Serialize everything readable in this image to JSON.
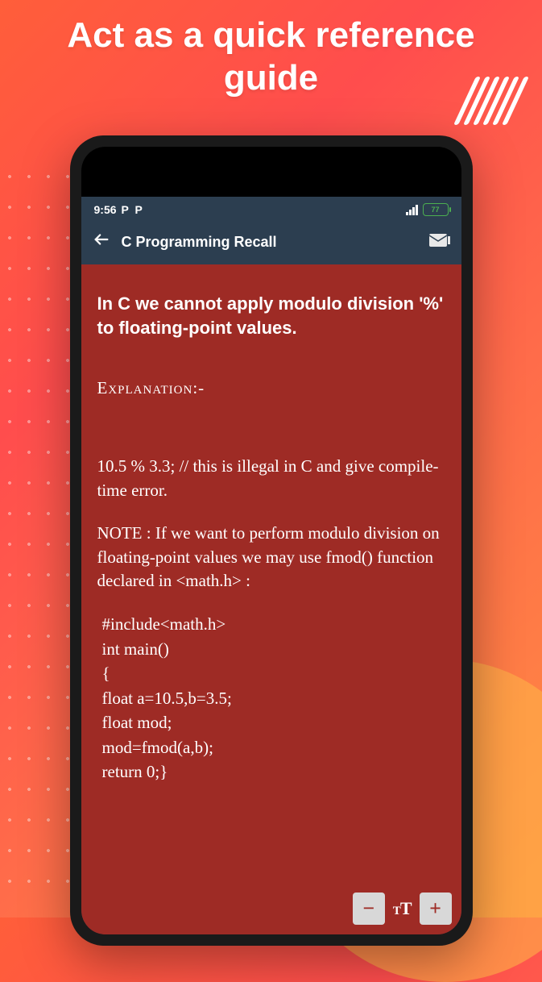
{
  "promo": {
    "title": "Act as a quick reference guide"
  },
  "status": {
    "time": "9:56",
    "indicator": "P  P",
    "battery": "77"
  },
  "appbar": {
    "title": "C Programming Recall"
  },
  "content": {
    "heading": "In C we cannot apply modulo division '%' to floating-point values.",
    "explanation_label": "Explanation:-",
    "example": " 10.5 % 3.3; // this is illegal in C and give compile-time error.",
    "note": "NOTE : If we want to perform modulo division on floating-point values we may use fmod() function declared in <math.h> :",
    "code": " #include<math.h>\nint main()\n{\nfloat a=10.5,b=3.5;\nfloat mod;\nmod=fmod(a,b);\nreturn 0;}"
  },
  "controls": {
    "minus": "−",
    "plus": "+",
    "textsize_small": "T",
    "textsize_big": "T"
  }
}
